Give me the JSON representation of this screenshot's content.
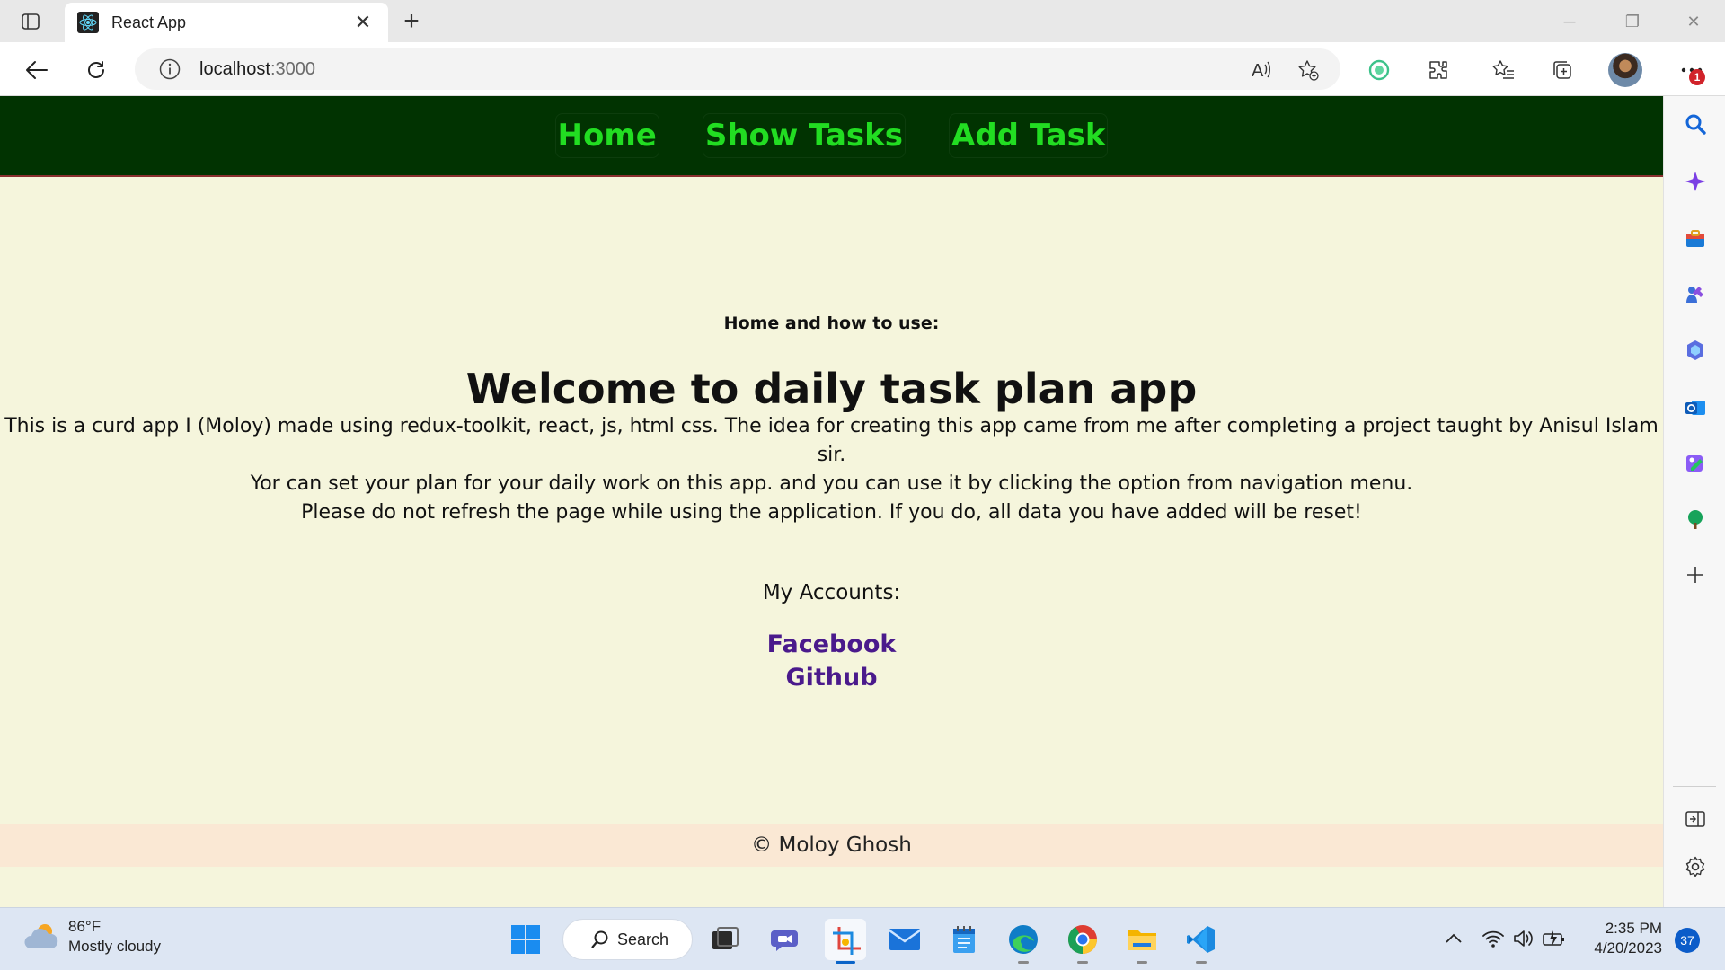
{
  "browser": {
    "tab_title": "React App",
    "url_host": "localhost",
    "url_port": ":3000",
    "notification_count": "1"
  },
  "nav": {
    "home": "Home",
    "show_tasks": "Show Tasks",
    "add_task": "Add Task"
  },
  "page": {
    "subtitle": "Home and how to use:",
    "headline": "Welcome to daily task plan app",
    "desc_lines": [
      "This is a curd app I (Moloy) made using redux-toolkit, react, js, html css. The idea for creating this app came from me after completing a project taught by Anisul Islam sir.",
      "Yor can set your plan for your daily work on this app. and you can use it by clicking the option from navigation menu.",
      "Please do not refresh the page while using the application. If you do, all data you have added will be reset!"
    ],
    "accounts_label": "My Accounts:",
    "accounts": [
      "Facebook",
      "Github"
    ],
    "footer": "© Moloy Ghosh"
  },
  "colors": {
    "navbar_bg": "#013301",
    "nav_link": "#22dd22",
    "page_bg": "#f5f5dc",
    "account_link": "#4a1a8c",
    "footer_bg": "#fae8d4"
  },
  "taskbar": {
    "temperature": "86°F",
    "weather": "Mostly cloudy",
    "search_label": "Search",
    "time": "2:35 PM",
    "date": "4/20/2023",
    "notifications": "37"
  }
}
